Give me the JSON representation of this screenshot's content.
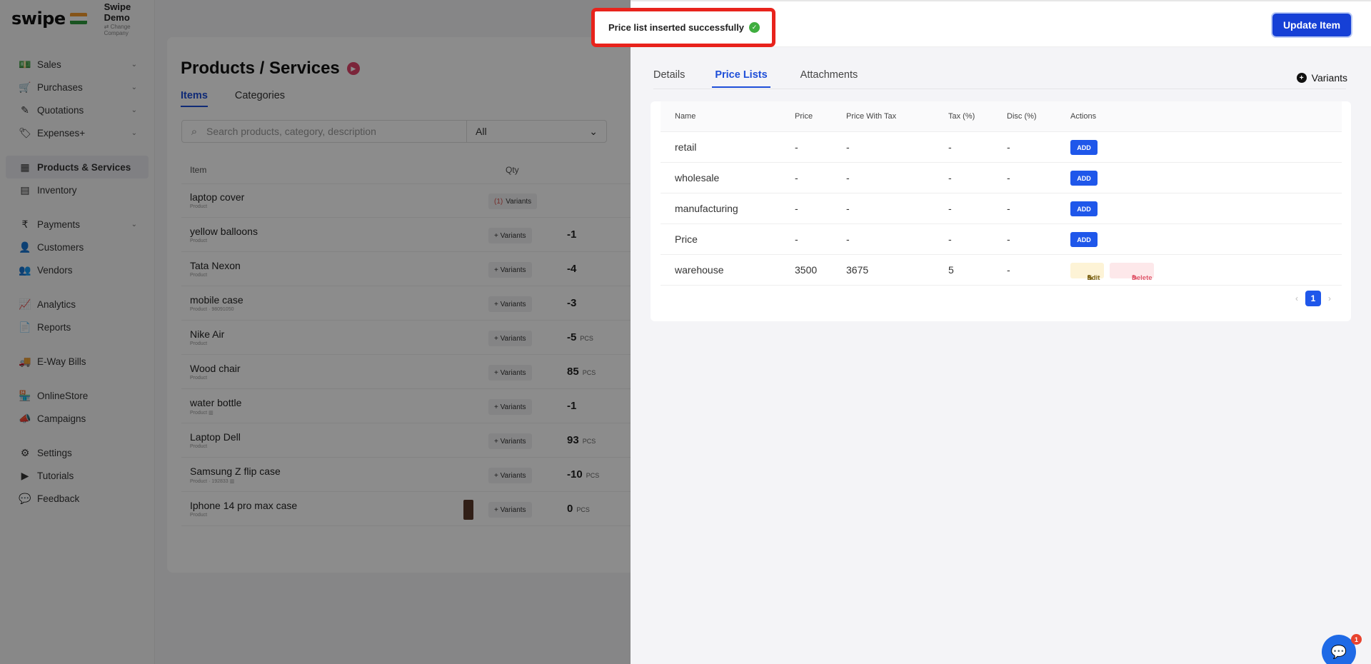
{
  "brand": {
    "logo": "swipe",
    "company_name": "Swipe Demo",
    "change_company": "⇄ Change Company"
  },
  "sidebar": {
    "items": [
      {
        "label": "Sales",
        "icon": "💵"
      },
      {
        "label": "Purchases",
        "icon": "🛒"
      },
      {
        "label": "Quotations",
        "icon": "✎"
      },
      {
        "label": "Expenses+",
        "icon": "🏷"
      },
      {
        "label": "Products & Services",
        "icon": "▦"
      },
      {
        "label": "Inventory",
        "icon": "▤"
      },
      {
        "label": "Payments",
        "icon": "₹"
      },
      {
        "label": "Customers",
        "icon": "👤"
      },
      {
        "label": "Vendors",
        "icon": "👥"
      },
      {
        "label": "Analytics",
        "icon": "📈"
      },
      {
        "label": "Reports",
        "icon": "📄"
      },
      {
        "label": "E-Way Bills",
        "icon": "🚚"
      },
      {
        "label": "OnlineStore",
        "icon": "🏪"
      },
      {
        "label": "Campaigns",
        "icon": "📣"
      },
      {
        "label": "Settings",
        "icon": "⚙"
      },
      {
        "label": "Tutorials",
        "icon": "▶"
      },
      {
        "label": "Feedback",
        "icon": "💬"
      }
    ]
  },
  "main": {
    "title": "Products / Services",
    "tabs": [
      "Items",
      "Categories"
    ],
    "search_placeholder": "Search products, category, description",
    "filter_value": "All",
    "col_item": "Item",
    "col_qty": "Qty",
    "products": [
      {
        "name": "laptop cover",
        "sub": "Product",
        "variants": "Variants",
        "variant_count": "(1)",
        "qty": "",
        "unit": ""
      },
      {
        "name": "yellow balloons",
        "sub": "Product",
        "variants": "+ Variants",
        "qty": "-1",
        "unit": ""
      },
      {
        "name": "Tata Nexon",
        "sub": "Product",
        "variants": "+ Variants",
        "qty": "-4",
        "unit": ""
      },
      {
        "name": "mobile case",
        "sub": "Product · 98091050",
        "variants": "+ Variants",
        "qty": "-3",
        "unit": ""
      },
      {
        "name": "Nike Air",
        "sub": "Product",
        "variants": "+ Variants",
        "qty": "-5",
        "unit": "PCS"
      },
      {
        "name": "Wood chair",
        "sub": "Product",
        "variants": "+ Variants",
        "qty": "85",
        "unit": "PCS"
      },
      {
        "name": "water bottle",
        "sub": "Product ▥",
        "variants": "+ Variants",
        "qty": "-1",
        "unit": ""
      },
      {
        "name": "Laptop Dell",
        "sub": "Product",
        "variants": "+ Variants",
        "qty": "93",
        "unit": "PCS"
      },
      {
        "name": "Samsung Z flip case",
        "sub": "Product · 192833 ▥",
        "variants": "+ Variants",
        "qty": "-10",
        "unit": "PCS"
      },
      {
        "name": "Iphone 14 pro max case",
        "sub": "Product",
        "variants": "+ Variants",
        "qty": "0",
        "unit": "PCS"
      }
    ]
  },
  "toast": {
    "message": "Price list inserted successfully",
    "icon": "✓"
  },
  "drawer": {
    "update_button": "Update Item",
    "tabs": [
      "Details",
      "Price Lists",
      "Attachments"
    ],
    "variants_link": "Variants",
    "table": {
      "headers": [
        "Name",
        "Price",
        "Price With Tax",
        "Tax (%)",
        "Disc (%)",
        "Actions"
      ],
      "rows": [
        {
          "name": "retail",
          "price": "-",
          "price_tax": "-",
          "tax": "-",
          "disc": "-",
          "action": "ADD"
        },
        {
          "name": "wholesale",
          "price": "-",
          "price_tax": "-",
          "tax": "-",
          "disc": "-",
          "action": "ADD"
        },
        {
          "name": "manufacturing",
          "price": "-",
          "price_tax": "-",
          "tax": "-",
          "disc": "-",
          "action": "ADD"
        },
        {
          "name": "Price",
          "price": "-",
          "price_tax": "-",
          "tax": "-",
          "disc": "-",
          "action": "ADD"
        },
        {
          "name": "warehouse",
          "price": "3500",
          "price_tax": "3675",
          "tax": "5",
          "disc": "-",
          "edit": "Edit",
          "delete": "Delete"
        }
      ]
    },
    "pagination": {
      "current": "1",
      "prev": "‹",
      "next": "›"
    }
  },
  "chat": {
    "badge": "1",
    "icon": "💬"
  }
}
